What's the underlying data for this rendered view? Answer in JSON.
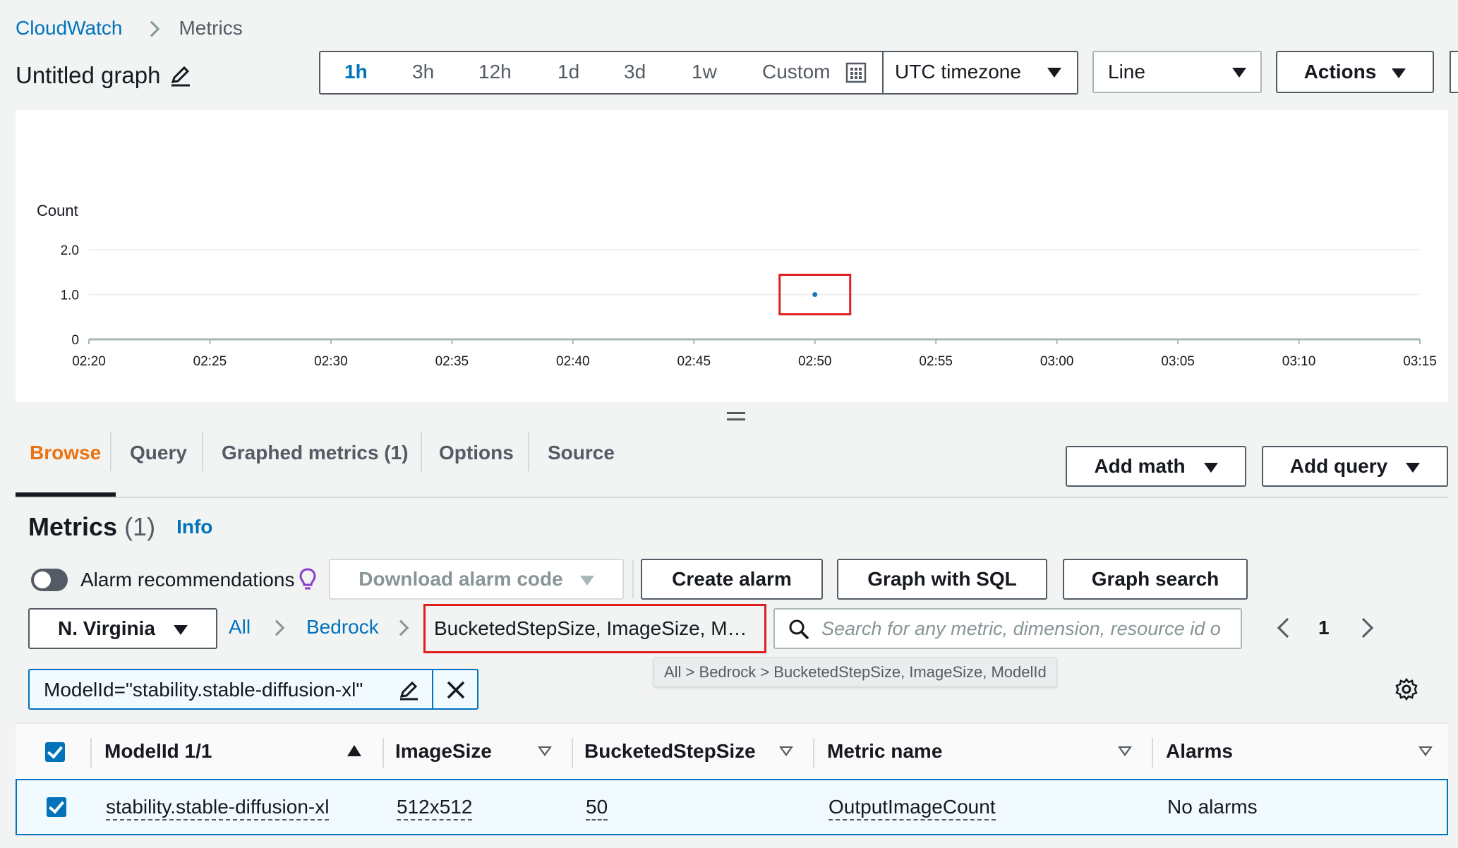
{
  "breadcrumb": {
    "root": "CloudWatch",
    "current": "Metrics"
  },
  "graph": {
    "title": "Untitled graph"
  },
  "time_range": {
    "options": [
      "1h",
      "3h",
      "12h",
      "1d",
      "3d",
      "1w"
    ],
    "selected": "1h",
    "custom_label": "Custom",
    "timezone": "UTC timezone"
  },
  "chart_type_select": "Line",
  "actions_label": "Actions",
  "chart_data": {
    "type": "scatter",
    "ylabel": "Count",
    "y_ticks": [
      "2.0",
      "1.0",
      "0"
    ],
    "ylim": [
      0,
      2
    ],
    "x_ticks": [
      "02:20",
      "02:25",
      "02:30",
      "02:35",
      "02:40",
      "02:45",
      "02:50",
      "02:55",
      "03:00",
      "03:05",
      "03:10",
      "03:15"
    ],
    "points": [
      {
        "x": "02:50",
        "y": 1.0
      }
    ],
    "highlight_color": "#e02020",
    "point_color": "#1f77b4"
  },
  "tabs": [
    "Browse",
    "Query",
    "Graphed metrics (1)",
    "Options",
    "Source"
  ],
  "active_tab": "Browse",
  "add_math_label": "Add math",
  "add_query_label": "Add query",
  "metrics": {
    "title": "Metrics",
    "count": "(1)",
    "info": "Info",
    "alarm_recommendations": "Alarm recommendations",
    "download_alarm_code": "Download alarm code",
    "create_alarm": "Create alarm",
    "graph_with_sql": "Graph with SQL",
    "graph_search": "Graph search"
  },
  "filter": {
    "region": "N. Virginia",
    "crumb_all": "All",
    "crumb_namespace": "Bedrock",
    "crumb_dimensions": "BucketedStepSize, ImageSize, M…",
    "search_placeholder": "Search for any metric, dimension, resource id o",
    "page": "1",
    "tooltip": "All > Bedrock > BucketedStepSize, ImageSize, ModelId",
    "token": "ModelId=\"stability.stable-diffusion-xl\""
  },
  "table": {
    "headers": [
      "ModelId 1/1",
      "ImageSize",
      "BucketedStepSize",
      "Metric name",
      "Alarms"
    ],
    "rows": [
      {
        "model_id": "stability.stable-diffusion-xl",
        "image_size": "512x512",
        "step_size": "50",
        "metric_name": "OutputImageCount",
        "alarms": "No alarms"
      }
    ]
  },
  "colors": {
    "accent": "#0073bb",
    "active_tab": "#ec7211",
    "highlight": "#e02020"
  }
}
